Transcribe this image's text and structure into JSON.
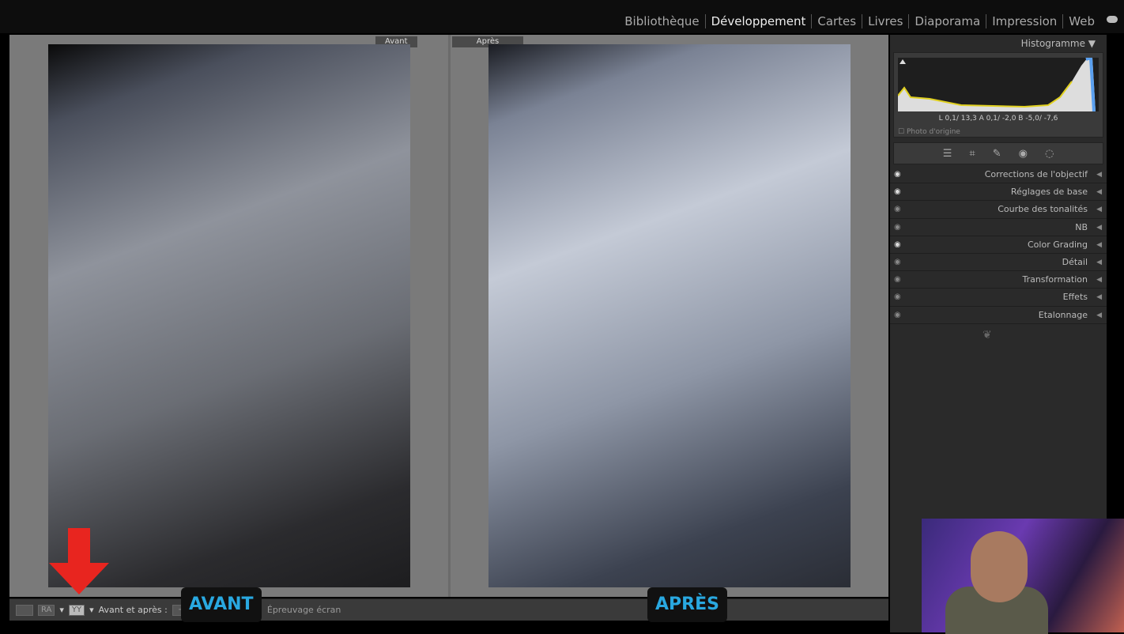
{
  "modules": [
    {
      "label": "Bibliothèque",
      "active": false
    },
    {
      "label": "Développement",
      "active": true
    },
    {
      "label": "Cartes",
      "active": false
    },
    {
      "label": "Livres",
      "active": false
    },
    {
      "label": "Diaporama",
      "active": false
    },
    {
      "label": "Impression",
      "active": false
    },
    {
      "label": "Web",
      "active": false
    }
  ],
  "view": {
    "before_label": "Avant",
    "after_label": "Après"
  },
  "toolbar": {
    "ra": "RA",
    "yy": "YY",
    "before_after_label": "Avant et après :",
    "proof": "Épreuvage écran"
  },
  "captions": {
    "before": "AVANT",
    "after": "APRÈS"
  },
  "histogram": {
    "title": "Histogramme",
    "values": "L   0,1/ 13,3  A   0,1/ -2,0  B  -5,0/ -7,6",
    "original": "Photo d'origine"
  },
  "tools": [
    "sliders-icon",
    "crop-icon",
    "heal-icon",
    "redeye-icon",
    "mask-icon"
  ],
  "panels": [
    {
      "label": "Corrections de l'objectif",
      "eye": true
    },
    {
      "label": "Réglages de base",
      "eye": true
    },
    {
      "label": "Courbe des tonalités",
      "eye": false
    },
    {
      "label": "NB",
      "eye": false
    },
    {
      "label": "Color Grading",
      "eye": true
    },
    {
      "label": "Détail",
      "eye": false
    },
    {
      "label": "Transformation",
      "eye": false
    },
    {
      "label": "Effets",
      "eye": false
    },
    {
      "label": "Etalonnage",
      "eye": false
    }
  ],
  "colors": {
    "caption": "#29a8e0",
    "arrow": "#e8251f"
  }
}
